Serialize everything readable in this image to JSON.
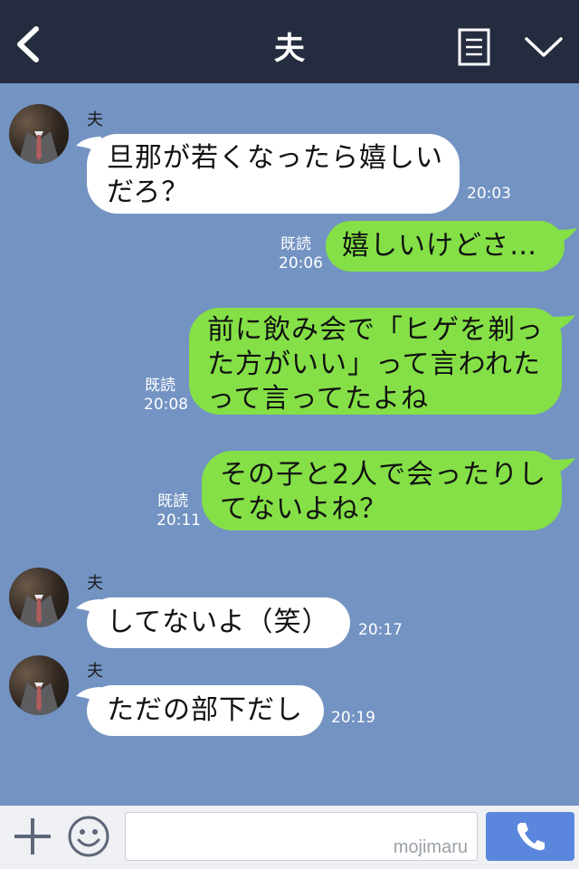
{
  "header": {
    "title": "夫"
  },
  "messages": [
    {
      "sender": "夫",
      "text": "旦那が若くなったら嬉しい\nだろ？",
      "time": "20:03"
    },
    {
      "read": "既読",
      "text": "嬉しいけどさ…",
      "time": "20:06"
    },
    {
      "read": "既読",
      "text": "前に飲み会で「ヒゲを剃っ\nた方がいい」って言われた\nって言ってたよね",
      "time": "20:08"
    },
    {
      "read": "既読",
      "text": "その子と2人で会ったりし\nてないよね？",
      "time": "20:11"
    },
    {
      "sender": "夫",
      "text": "してないよ（笑）",
      "time": "20:17"
    },
    {
      "sender": "夫",
      "text": "ただの部下だし",
      "time": "20:19"
    }
  ],
  "input": {
    "watermark": "mojimaru"
  },
  "colors": {
    "header": "#252c3f",
    "chat_bg": "#7393c2",
    "outgoing": "#84e046",
    "incoming": "#ffffff",
    "call": "#5b86dd"
  }
}
